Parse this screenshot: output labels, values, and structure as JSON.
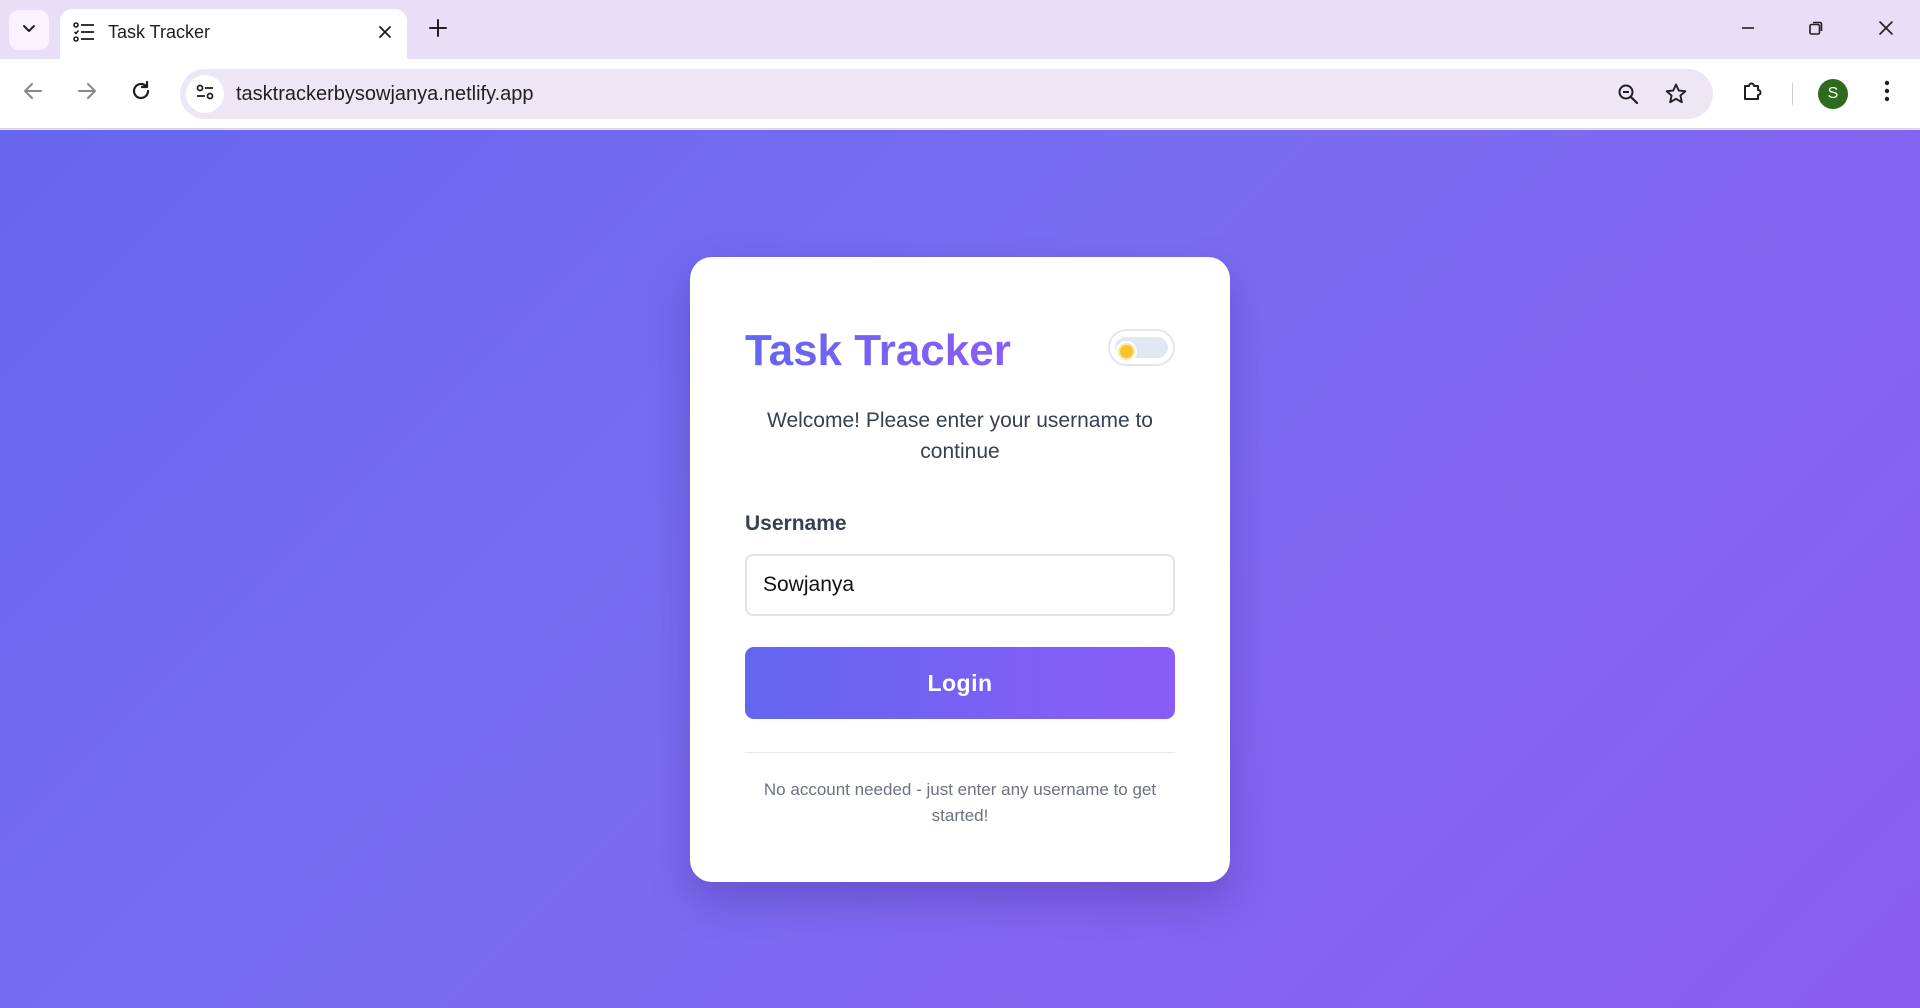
{
  "browser": {
    "tab_title": "Task Tracker",
    "url": "tasktrackerbysowjanya.netlify.app",
    "avatar_letter": "S"
  },
  "icons": {
    "tab_menu": "chevron-down-icon",
    "favicon": "checklist-icon",
    "tab_close": "close-icon",
    "new_tab": "plus-icon",
    "back": "arrow-left-icon",
    "forward": "arrow-right-icon",
    "reload": "reload-icon",
    "site_info": "tune-icon",
    "zoom": "zoom-out-icon",
    "bookmark": "star-icon",
    "extensions": "puzzle-icon",
    "menu": "kebab-menu-icon",
    "theme_toggle": "sun-icon"
  },
  "login": {
    "title": "Task Tracker",
    "welcome": "Welcome! Please enter your username to continue",
    "username_label": "Username",
    "username_value": "Sowjanya",
    "button_label": "Login",
    "footnote": "No account needed - just enter any username to get started!"
  },
  "colors": {
    "accent_start": "#6366f1",
    "accent_end": "#8b5cf6",
    "background_start": "#6766ef",
    "background_end": "#8b5cf0",
    "sun": "#f7c32b"
  }
}
